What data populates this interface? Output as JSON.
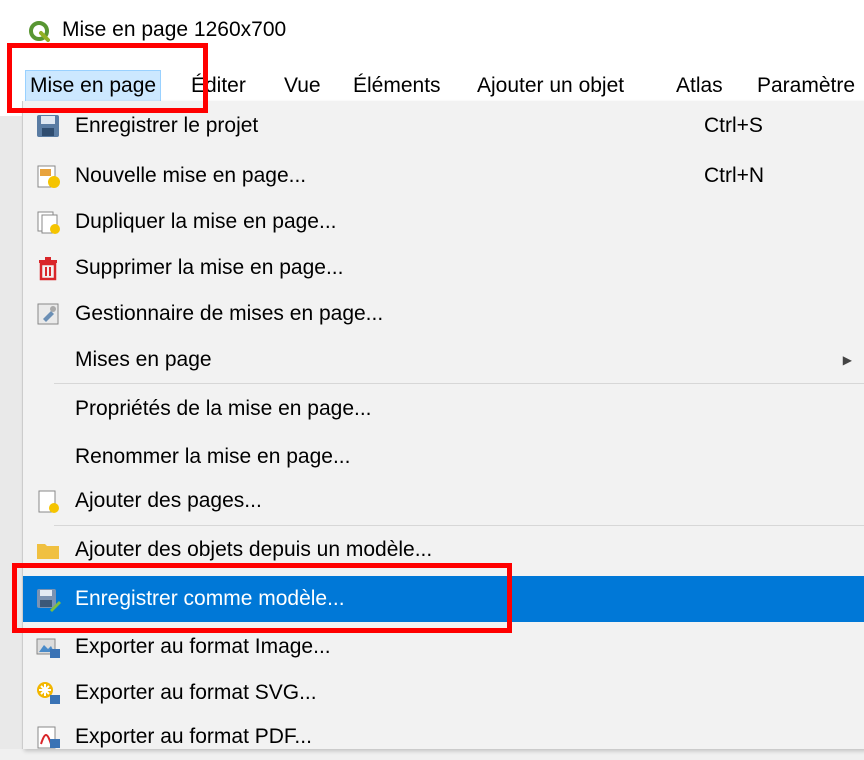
{
  "window": {
    "title": "Mise en page 1260x700"
  },
  "menubar": {
    "items": [
      {
        "label": "Mise en page"
      },
      {
        "label": "Éditer"
      },
      {
        "label": "Vue"
      },
      {
        "label": "Éléments"
      },
      {
        "label": "Ajouter un objet"
      },
      {
        "label": "Atlas"
      },
      {
        "label": "Paramètre"
      }
    ]
  },
  "menu": {
    "items": [
      {
        "label": "Enregistrer le projet",
        "shortcut": "Ctrl+S",
        "icon": "save-icon"
      },
      {
        "label": "Nouvelle mise en page...",
        "shortcut": "Ctrl+N",
        "icon": "new-layout-icon"
      },
      {
        "label": "Dupliquer la mise en page...",
        "shortcut": "",
        "icon": "duplicate-layout-icon"
      },
      {
        "label": "Supprimer la mise en page...",
        "shortcut": "",
        "icon": "trash-icon"
      },
      {
        "label": "Gestionnaire de mises en page...",
        "shortcut": "",
        "icon": "layout-manager-icon"
      },
      {
        "label": "Mises en page",
        "shortcut": "",
        "icon": ""
      },
      {
        "label": "Propriétés de la mise en page...",
        "shortcut": "",
        "icon": ""
      },
      {
        "label": "Renommer la mise en page...",
        "shortcut": "",
        "icon": ""
      },
      {
        "label": "Ajouter des pages...",
        "shortcut": "",
        "icon": "add-pages-icon"
      },
      {
        "label": "Ajouter des objets depuis un modèle...",
        "shortcut": "",
        "icon": "folder-icon"
      },
      {
        "label": "Enregistrer comme modèle...",
        "shortcut": "",
        "icon": "save-as-template-icon"
      },
      {
        "label": "Exporter au format Image...",
        "shortcut": "",
        "icon": "export-image-icon"
      },
      {
        "label": "Exporter au format SVG...",
        "shortcut": "",
        "icon": "export-svg-icon"
      },
      {
        "label": "Exporter au format PDF...",
        "shortcut": "",
        "icon": "export-pdf-icon"
      }
    ]
  },
  "colors": {
    "highlight": "#0078d7",
    "annotation": "#ff0000"
  }
}
